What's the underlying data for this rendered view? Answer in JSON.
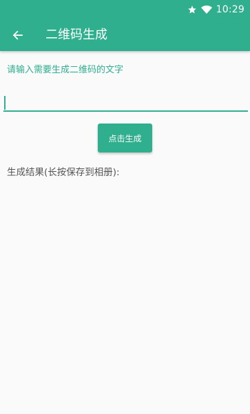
{
  "status_bar": {
    "time": "10:29",
    "icons": [
      "star-icon",
      "wifi-icon"
    ]
  },
  "app_bar": {
    "back_icon": "arrow-left-icon",
    "title": "二维码生成"
  },
  "form": {
    "prompt_label": "请输入需要生成二维码的文字",
    "input_value": "",
    "input_placeholder": "",
    "generate_button_label": "点击生成"
  },
  "result": {
    "label": "生成结果(长按保存到相册):"
  },
  "colors": {
    "accent": "#2faf8d",
    "background": "#fafafa",
    "text_secondary": "#555555"
  }
}
